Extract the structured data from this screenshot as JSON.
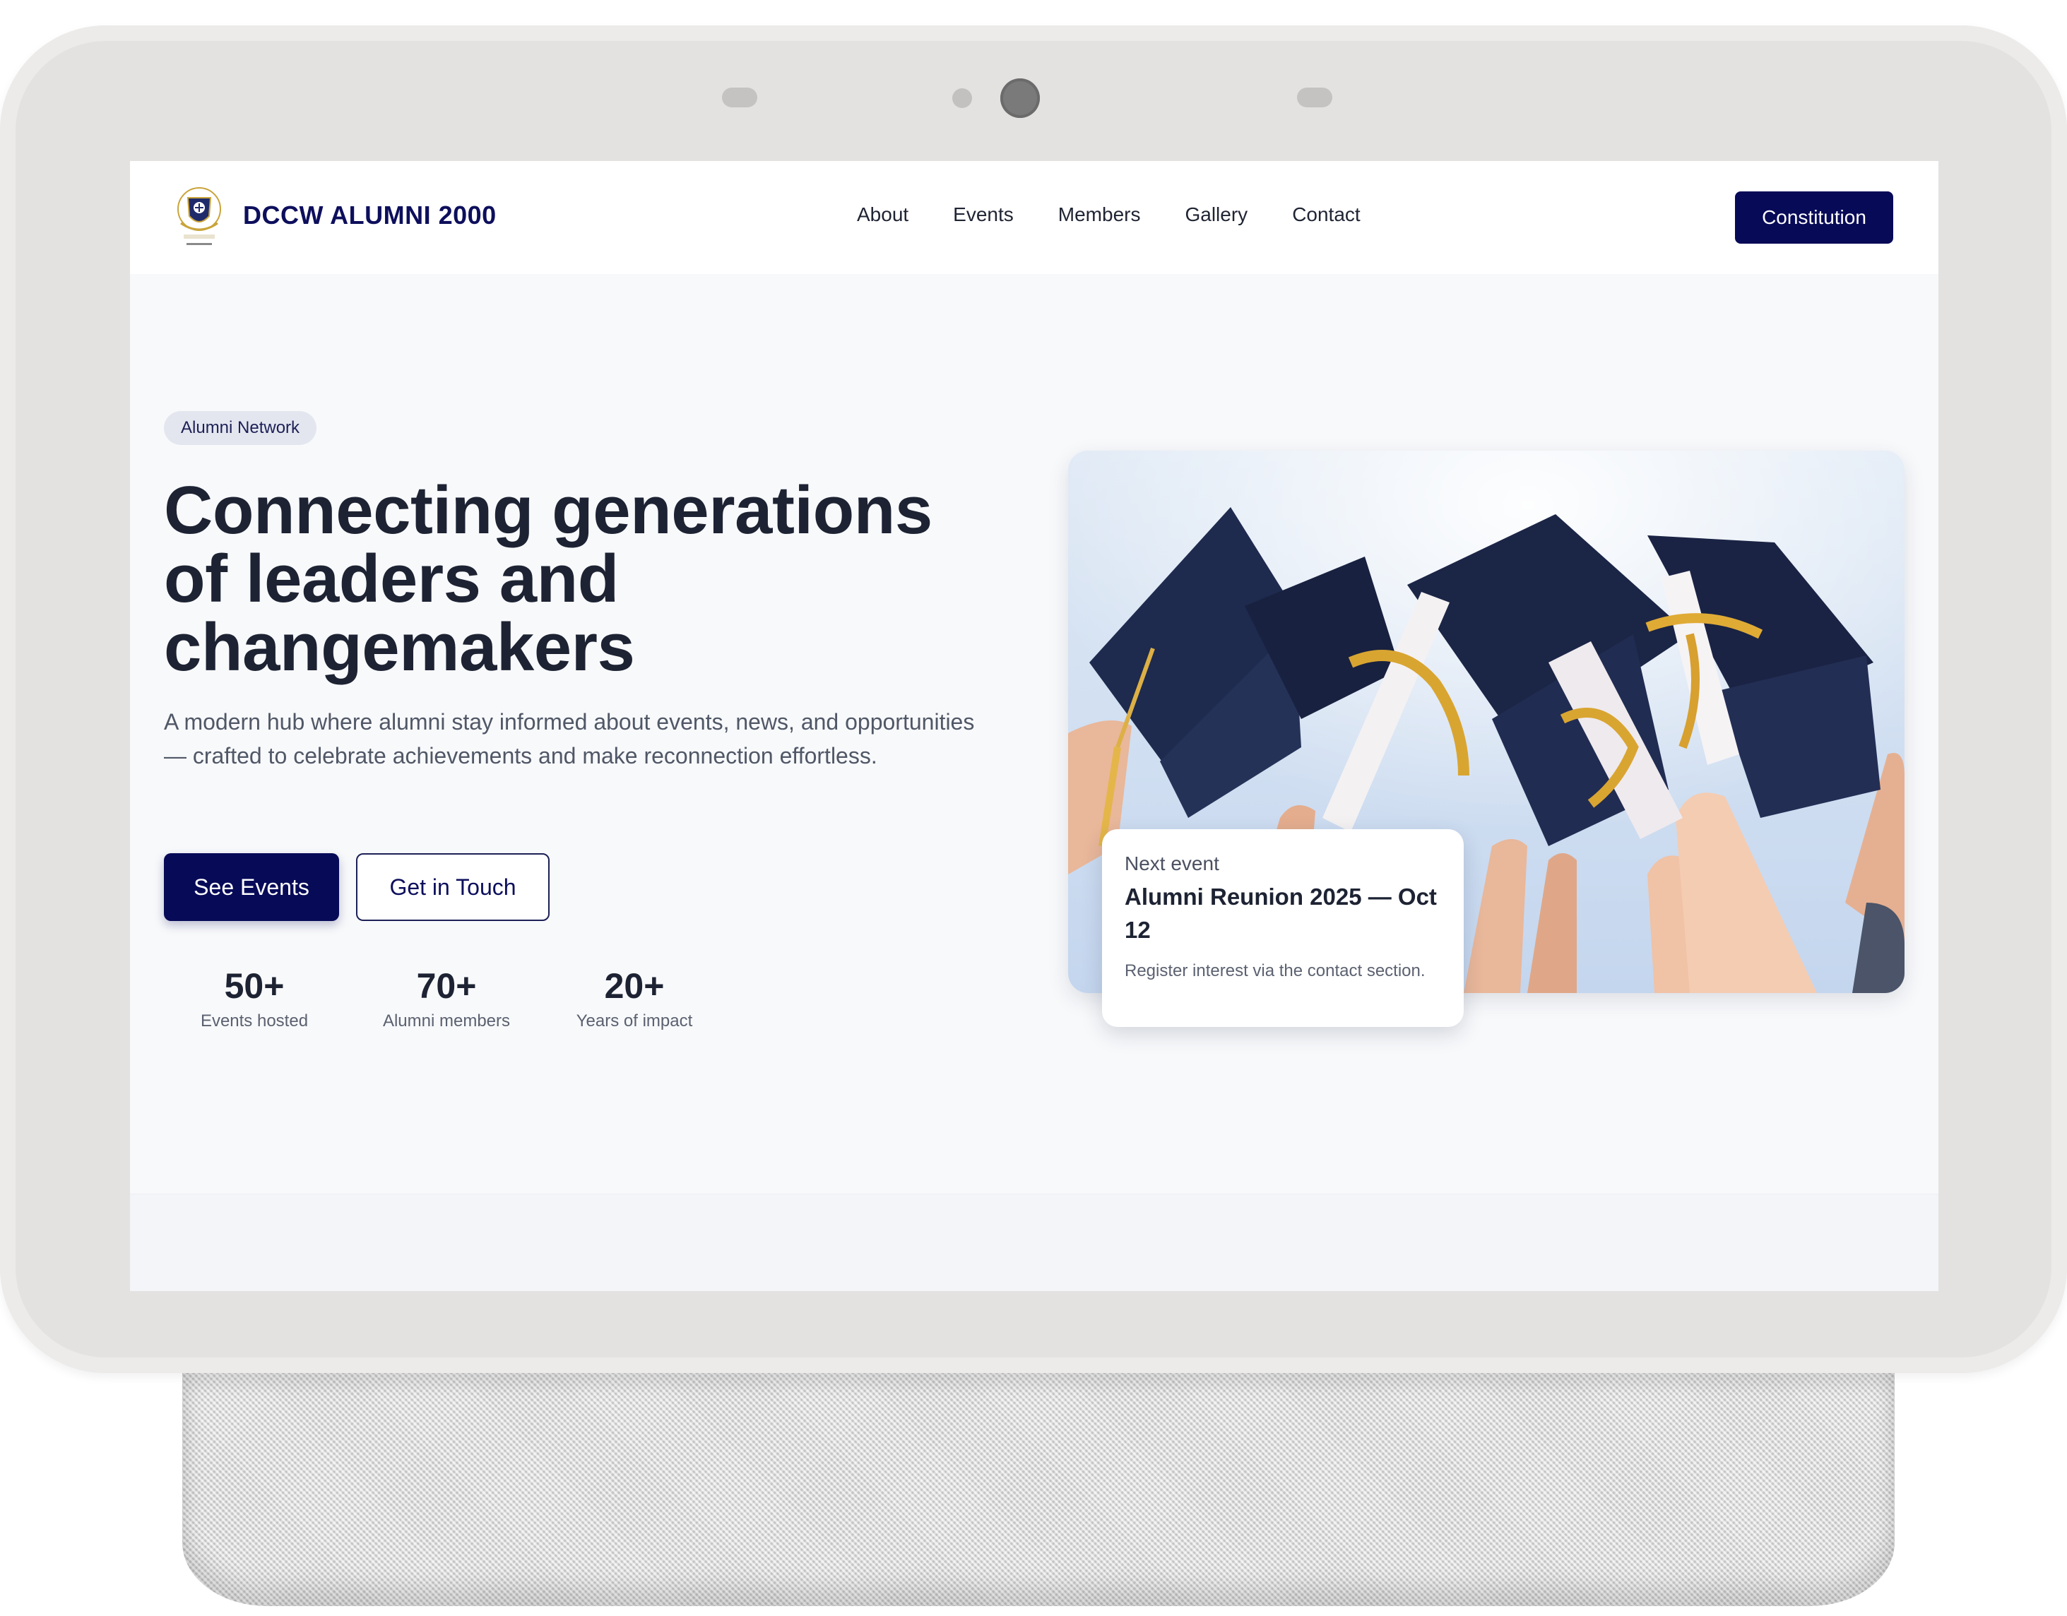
{
  "brand": {
    "name": "DCCW ALUMNI 2000",
    "logo_icon": "school-crest-icon"
  },
  "nav": {
    "links": [
      "About",
      "Events",
      "Members",
      "Gallery",
      "Contact"
    ],
    "cta_label": "Constitution"
  },
  "hero": {
    "pill": "Alumni Network",
    "headline_lines": [
      "Connecting generations",
      "of leaders and",
      "changemakers"
    ],
    "subtext": "A modern hub where alumni stay informed about events, news, and opportunities — crafted to celebrate achievements and make reconnection effortless.",
    "primary_button": "See Events",
    "secondary_button": "Get in Touch",
    "stats": [
      {
        "value": "50+",
        "label": "Events hosted"
      },
      {
        "value": "70+",
        "label": "Alumni members"
      },
      {
        "value": "20+",
        "label": "Years of impact"
      }
    ]
  },
  "event_card": {
    "kicker": "Next event",
    "title": "Alumni Reunion 2025 — Oct 12",
    "note": "Register interest via the contact section."
  },
  "colors": {
    "brand_navy": "#070a57",
    "text_dark": "#1d2333",
    "device_frame": "#e3e2e1",
    "screen_bg": "#f8f9fb"
  }
}
